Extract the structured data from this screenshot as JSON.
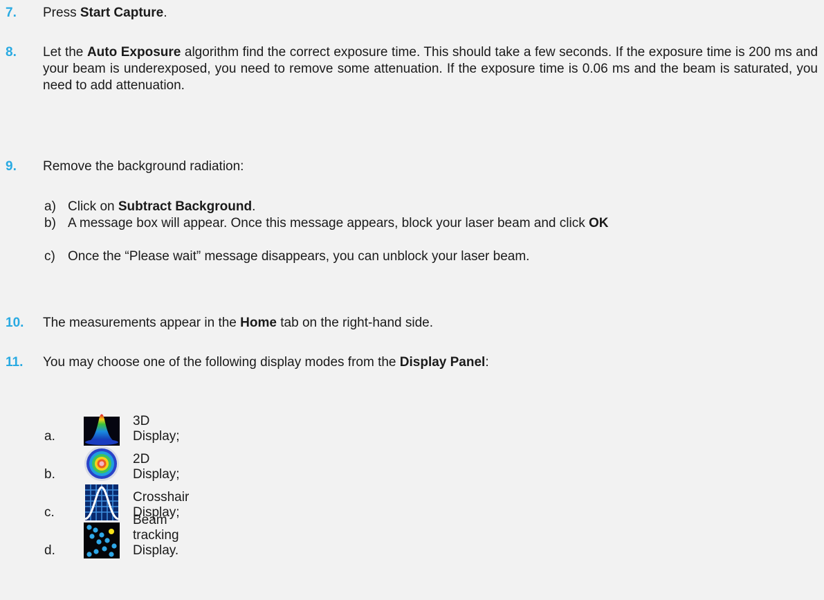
{
  "steps": {
    "s7": {
      "num": "7.",
      "pre": "Press ",
      "b1": "Start Capture",
      "post": "."
    },
    "s8": {
      "num": "8.",
      "pre": "Let the ",
      "b1": "Auto Exposure",
      "post": " algorithm find the correct exposure time. This should take a few seconds. If the exposure time is 200 ms and your beam is underexposed, you need to remove some attenuation. If the exposure time is 0.06 ms and the beam is saturated, you need to add attenuation."
    },
    "s9": {
      "num": "9.",
      "text": "Remove the background radiation:",
      "a": {
        "label": "a)",
        "pre": "Click on ",
        "b1": "Subtract Background",
        "post": "."
      },
      "b": {
        "label": "b)",
        "pre": "A message box will appear. Once this message appears, block your laser beam and click ",
        "b1": "OK"
      },
      "c": {
        "label": "c)",
        "text": "Once the “Please wait” message disappears, you can unblock your laser beam."
      }
    },
    "s10": {
      "num": "10.",
      "pre": "The measurements appear in the ",
      "b1": "Home",
      "post": " tab on the right-hand side."
    },
    "s11": {
      "num": "11.",
      "pre": "You may choose one of the following display modes from the ",
      "b1": "Display Panel",
      "post": ":"
    }
  },
  "modes": [
    {
      "label": "a.",
      "icon": "3d-display-icon",
      "text": "3D Display;"
    },
    {
      "label": "b.",
      "icon": "2d-display-icon",
      "text": "2D Display;"
    },
    {
      "label": "c.",
      "icon": "crosshair-display-icon",
      "text": "Crosshair Display;"
    },
    {
      "label": "d.",
      "icon": "beam-tracking-display-icon",
      "text": "Beam tracking Display."
    }
  ],
  "colors": {
    "step_number": "#29aae2",
    "background": "#f2f2f2",
    "text": "#1a1a1a"
  }
}
